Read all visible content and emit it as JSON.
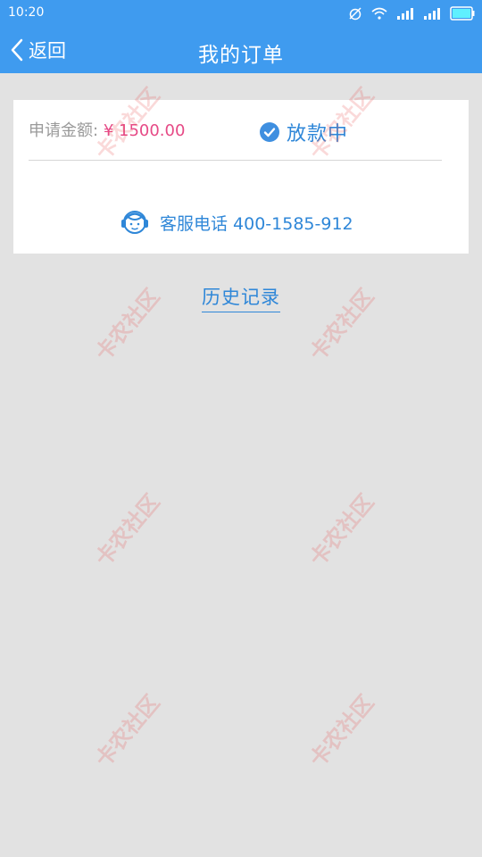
{
  "status_bar": {
    "time": "10:20",
    "icons": [
      "alarm-off-icon",
      "wifi-icon",
      "signal-icon",
      "signal-icon-2",
      "battery-icon"
    ]
  },
  "nav": {
    "back_label": "返回",
    "title": "我的订单"
  },
  "order": {
    "amount_label": "申请金额:",
    "amount_value": "¥ 1500.00",
    "status": "放款中",
    "hotline": "客服电话 400-1585-912"
  },
  "history_link": "历史记录",
  "watermark_text": "卡农社区",
  "colors": {
    "primary": "#3f9bef",
    "link_blue": "#2f87d8",
    "amount_pink": "#e64a86",
    "background": "#e2e2e2"
  }
}
